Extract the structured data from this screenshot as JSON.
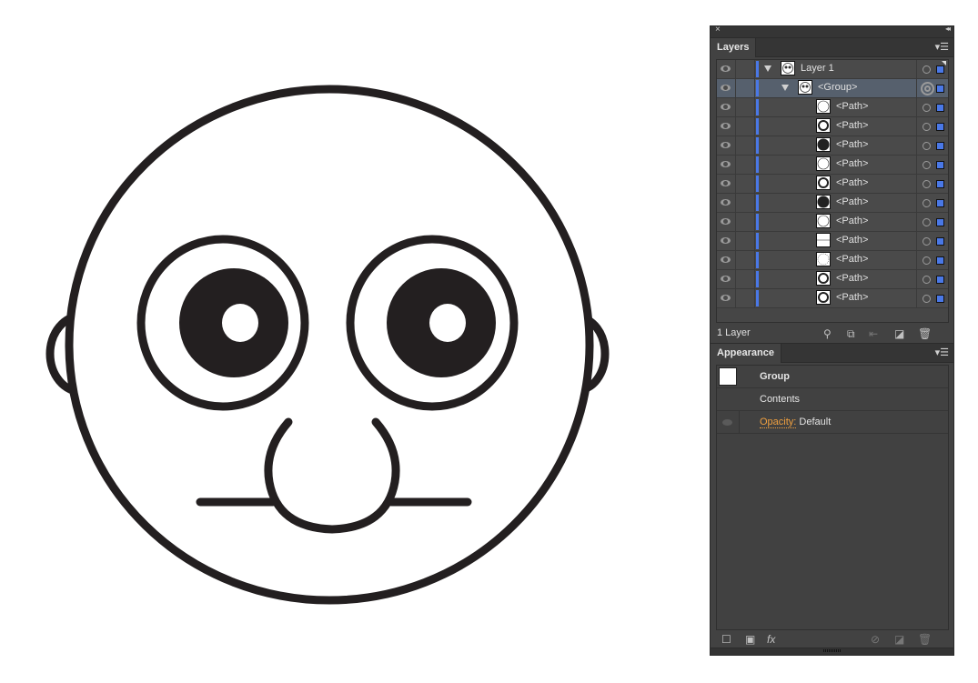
{
  "artwork": {
    "name": "face-illustration",
    "stroke_color": "#231f20",
    "fill_color": "#ffffff"
  },
  "panel": {
    "close_label": "×",
    "collapse_label": "◂◂",
    "layers": {
      "tab_label": "Layers",
      "menu_icon": "panel-menu-icon",
      "layer_color": "#4a78e6",
      "rows": [
        {
          "name": "Layer 1",
          "level": 0,
          "expanded": true,
          "thumb": "face",
          "selected": false
        },
        {
          "name": "<Group>",
          "level": 1,
          "expanded": true,
          "thumb": "face",
          "selected": true
        },
        {
          "name": "<Path>",
          "level": 2,
          "thumb": "circle-outline"
        },
        {
          "name": "<Path>",
          "level": 2,
          "thumb": "ring"
        },
        {
          "name": "<Path>",
          "level": 2,
          "thumb": "filled-circle"
        },
        {
          "name": "<Path>",
          "level": 2,
          "thumb": "circle-outline"
        },
        {
          "name": "<Path>",
          "level": 2,
          "thumb": "ring"
        },
        {
          "name": "<Path>",
          "level": 2,
          "thumb": "filled-circle"
        },
        {
          "name": "<Path>",
          "level": 2,
          "thumb": "circle-outline"
        },
        {
          "name": "<Path>",
          "level": 2,
          "thumb": "line"
        },
        {
          "name": "<Path>",
          "level": 2,
          "thumb": "dotted-circle"
        },
        {
          "name": "<Path>",
          "level": 2,
          "thumb": "ring"
        },
        {
          "name": "<Path>",
          "level": 2,
          "thumb": "ring"
        }
      ],
      "footer_label": "1 Layer"
    },
    "appearance": {
      "tab_label": "Appearance",
      "rows": [
        {
          "label": "Group"
        },
        {
          "label": "Contents"
        },
        {
          "label_link": "Opacity:",
          "value": "Default"
        }
      ],
      "fx_label": "fx"
    }
  }
}
